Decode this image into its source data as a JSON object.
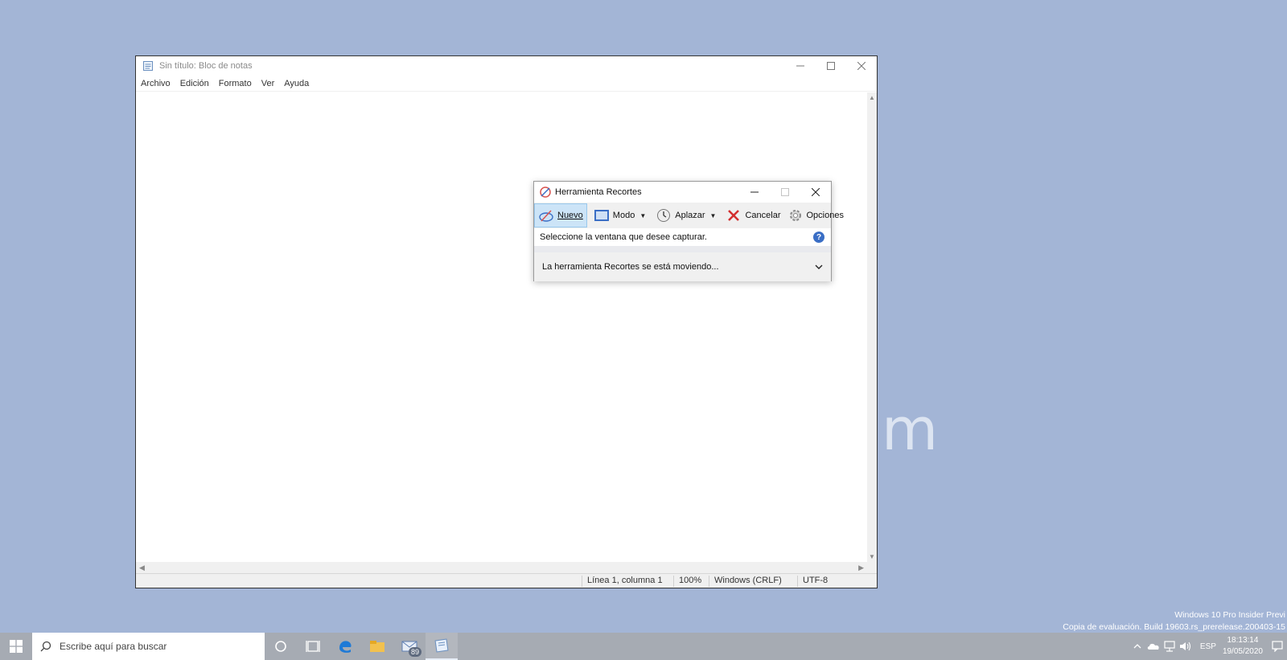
{
  "desktop": {
    "watermark": "m"
  },
  "notepad": {
    "title": "Sin título: Bloc de notas",
    "menu": [
      "Archivo",
      "Edición",
      "Formato",
      "Ver",
      "Ayuda"
    ],
    "status": {
      "position": "Línea 1, columna 1",
      "zoom": "100%",
      "line_endings": "Windows (CRLF)",
      "encoding": "UTF-8"
    }
  },
  "snipping_tool": {
    "title": "Herramienta Recortes",
    "toolbar": {
      "new_label": "Nuevo",
      "mode_label": "Modo",
      "delay_label": "Aplazar",
      "cancel_label": "Cancelar",
      "options_label": "Opciones"
    },
    "hint": "Seleccione la ventana que desee capturar.",
    "message": "La herramienta Recortes se está moviendo..."
  },
  "eval_watermark": {
    "line1": "Windows 10 Pro Insider Previ",
    "line2": "Copia de evaluación. Build 19603.rs_prerelease.200403-15"
  },
  "taskbar": {
    "search_placeholder": "Escribe aquí para buscar",
    "mail_badge": "89",
    "language": "ESP",
    "time": "18:13:14",
    "date": "19/05/2020"
  },
  "colors": {
    "desktop": "#a3b5d6",
    "taskbar": "#a6abb3",
    "selected_button": "#cce4f7"
  },
  "icons": [
    "notepad-icon",
    "snipping-tool-icon",
    "windows-start-icon",
    "search-icon",
    "cortana-icon",
    "task-view-icon",
    "edge-icon",
    "file-explorer-icon",
    "mail-icon"
  ]
}
